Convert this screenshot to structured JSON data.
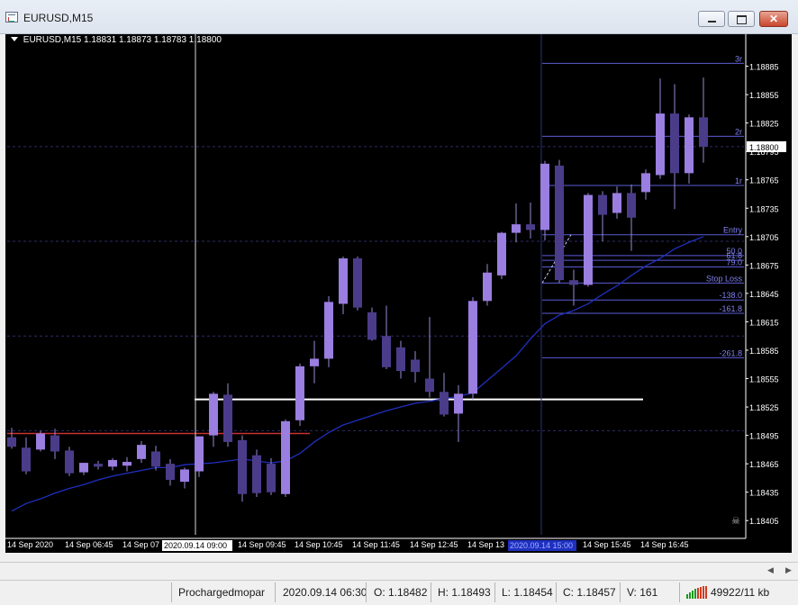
{
  "window": {
    "title": "EURUSD,M15"
  },
  "chart_header": {
    "symbol_tf": "EURUSD,M15",
    "ohlc": "1.18831 1.18873 1.18783 1.18800"
  },
  "chart_data": {
    "type": "candlestick",
    "title": "",
    "ylim": [
      1.1839,
      1.18915
    ],
    "price_ticks": [
      1.18885,
      1.18855,
      1.18825,
      1.18795,
      1.18765,
      1.18735,
      1.18705,
      1.18675,
      1.18645,
      1.18615,
      1.18585,
      1.18555,
      1.18525,
      1.18495,
      1.18465,
      1.18435,
      1.18405
    ],
    "price_tick_labels": [
      "1.18885",
      "1.18855",
      "1.18825",
      "1.18795",
      "1.18765",
      "1.18735",
      "1.18705",
      "1.18675",
      "1.18645",
      "1.18615",
      "1.18585",
      "1.18555",
      "1.18525",
      "1.18495",
      "1.18465",
      "1.18435",
      "1.18405"
    ],
    "time_labels": [
      "14 Sep 2020",
      "14 Sep 06:45",
      "14 Sep 07",
      "14 Sep 09:45",
      "14 Sep 10:45",
      "14 Sep 11:45",
      "14 Sep 12:45",
      "14 Sep 13",
      "14 Sep 15:45",
      "14 Sep 16:45"
    ],
    "crosshair_time_label": "2020.09.14 09:00",
    "cursor_time_label": "2020.09.14 15:00",
    "current_price_label": "1.18800",
    "candles": [
      {
        "o": 1.18493,
        "h": 1.18503,
        "l": 1.18481,
        "c": 1.18483
      },
      {
        "o": 1.18482,
        "h": 1.18493,
        "l": 1.18454,
        "c": 1.18457
      },
      {
        "o": 1.1848,
        "h": 1.185,
        "l": 1.18478,
        "c": 1.18497
      },
      {
        "o": 1.18495,
        "h": 1.18502,
        "l": 1.1847,
        "c": 1.18478
      },
      {
        "o": 1.18479,
        "h": 1.18483,
        "l": 1.18452,
        "c": 1.18455
      },
      {
        "o": 1.18456,
        "h": 1.18466,
        "l": 1.18453,
        "c": 1.18466
      },
      {
        "o": 1.18465,
        "h": 1.18468,
        "l": 1.18459,
        "c": 1.18462
      },
      {
        "o": 1.18462,
        "h": 1.18471,
        "l": 1.18458,
        "c": 1.18469
      },
      {
        "o": 1.18463,
        "h": 1.18472,
        "l": 1.18457,
        "c": 1.18467
      },
      {
        "o": 1.1847,
        "h": 1.18489,
        "l": 1.18466,
        "c": 1.18485
      },
      {
        "o": 1.18478,
        "h": 1.18484,
        "l": 1.18458,
        "c": 1.18462
      },
      {
        "o": 1.18465,
        "h": 1.1847,
        "l": 1.18442,
        "c": 1.18448
      },
      {
        "o": 1.18446,
        "h": 1.18461,
        "l": 1.18439,
        "c": 1.18459
      },
      {
        "o": 1.18457,
        "h": 1.18494,
        "l": 1.18451,
        "c": 1.18494
      },
      {
        "o": 1.18495,
        "h": 1.18541,
        "l": 1.18483,
        "c": 1.18539
      },
      {
        "o": 1.18538,
        "h": 1.1855,
        "l": 1.18483,
        "c": 1.18488
      },
      {
        "o": 1.1849,
        "h": 1.18495,
        "l": 1.18425,
        "c": 1.18433
      },
      {
        "o": 1.18474,
        "h": 1.1848,
        "l": 1.1843,
        "c": 1.18434
      },
      {
        "o": 1.18465,
        "h": 1.18471,
        "l": 1.18432,
        "c": 1.18435
      },
      {
        "o": 1.18433,
        "h": 1.18512,
        "l": 1.1843,
        "c": 1.1851
      },
      {
        "o": 1.18511,
        "h": 1.18571,
        "l": 1.18505,
        "c": 1.18568
      },
      {
        "o": 1.18568,
        "h": 1.18595,
        "l": 1.1855,
        "c": 1.18576
      },
      {
        "o": 1.18576,
        "h": 1.18642,
        "l": 1.18567,
        "c": 1.18636
      },
      {
        "o": 1.18634,
        "h": 1.18684,
        "l": 1.18623,
        "c": 1.18682
      },
      {
        "o": 1.18682,
        "h": 1.18684,
        "l": 1.18627,
        "c": 1.1863
      },
      {
        "o": 1.18625,
        "h": 1.1863,
        "l": 1.18595,
        "c": 1.18596
      },
      {
        "o": 1.186,
        "h": 1.18632,
        "l": 1.18565,
        "c": 1.18567
      },
      {
        "o": 1.18588,
        "h": 1.18595,
        "l": 1.18555,
        "c": 1.18563
      },
      {
        "o": 1.18575,
        "h": 1.18584,
        "l": 1.18551,
        "c": 1.18562
      },
      {
        "o": 1.18555,
        "h": 1.1862,
        "l": 1.18535,
        "c": 1.18541
      },
      {
        "o": 1.18541,
        "h": 1.18561,
        "l": 1.18515,
        "c": 1.18517
      },
      {
        "o": 1.18518,
        "h": 1.18548,
        "l": 1.18488,
        "c": 1.18539
      },
      {
        "o": 1.18539,
        "h": 1.18641,
        "l": 1.18533,
        "c": 1.18637
      },
      {
        "o": 1.18637,
        "h": 1.18676,
        "l": 1.18632,
        "c": 1.18667
      },
      {
        "o": 1.18664,
        "h": 1.1871,
        "l": 1.1866,
        "c": 1.18709
      },
      {
        "o": 1.18709,
        "h": 1.1874,
        "l": 1.18699,
        "c": 1.18718
      },
      {
        "o": 1.18718,
        "h": 1.18741,
        "l": 1.18703,
        "c": 1.18712
      },
      {
        "o": 1.18712,
        "h": 1.18785,
        "l": 1.18701,
        "c": 1.18782
      },
      {
        "o": 1.1878,
        "h": 1.18786,
        "l": 1.18656,
        "c": 1.18659
      },
      {
        "o": 1.18659,
        "h": 1.1867,
        "l": 1.18632,
        "c": 1.18654
      },
      {
        "o": 1.18654,
        "h": 1.18751,
        "l": 1.18652,
        "c": 1.18749
      },
      {
        "o": 1.18749,
        "h": 1.18753,
        "l": 1.187,
        "c": 1.18728
      },
      {
        "o": 1.1873,
        "h": 1.18758,
        "l": 1.18724,
        "c": 1.18751
      },
      {
        "o": 1.18751,
        "h": 1.1876,
        "l": 1.1869,
        "c": 1.18725
      },
      {
        "o": 1.18752,
        "h": 1.18776,
        "l": 1.18744,
        "c": 1.18772
      },
      {
        "o": 1.1877,
        "h": 1.18872,
        "l": 1.18766,
        "c": 1.18835
      },
      {
        "o": 1.18835,
        "h": 1.18866,
        "l": 1.18734,
        "c": 1.18772
      },
      {
        "o": 1.18772,
        "h": 1.18834,
        "l": 1.18761,
        "c": 1.18831
      },
      {
        "o": 1.18831,
        "h": 1.18873,
        "l": 1.18783,
        "c": 1.188
      }
    ],
    "moving_average": [
      1.18415,
      1.18423,
      1.18428,
      1.18434,
      1.18439,
      1.18443,
      1.18448,
      1.18452,
      1.18455,
      1.18458,
      1.18461,
      1.18461,
      1.18464,
      1.18465,
      1.18466,
      1.18468,
      1.1847,
      1.18468,
      1.18466,
      1.18468,
      1.18476,
      1.18488,
      1.18498,
      1.18506,
      1.18511,
      1.18516,
      1.18521,
      1.18525,
      1.18529,
      1.18531,
      1.18534,
      1.18536,
      1.1854,
      1.18553,
      1.18566,
      1.18579,
      1.18597,
      1.18613,
      1.18622,
      1.18627,
      1.18634,
      1.18644,
      1.18653,
      1.18664,
      1.18674,
      1.18682,
      1.18692,
      1.18699,
      1.18705
    ],
    "levels": [
      {
        "label": "3r",
        "price": 1.18888
      },
      {
        "label": "2r",
        "price": 1.18811
      },
      {
        "label": "1r",
        "price": 1.18759
      },
      {
        "label": "Entry",
        "price": 1.18707
      },
      {
        "label": "50.0",
        "price": 1.18685
      },
      {
        "label": "61.8",
        "price": 1.1868
      },
      {
        "label": "79.0",
        "price": 1.18673
      },
      {
        "label": "Stop Loss",
        "price": 1.18656
      },
      {
        "label": "-138.0",
        "price": 1.18638
      },
      {
        "label": "-161.8",
        "price": 1.18624
      },
      {
        "label": "-261.8",
        "price": 1.18577
      }
    ],
    "grid_prices": [
      1.188,
      1.187,
      1.186,
      1.185
    ],
    "white_level_price": 1.18533,
    "red_level_price": 1.18497,
    "colors": {
      "background": "#000000",
      "bull": "#9a7ee0",
      "bear": "#4b3c8a",
      "wick": "#9a8ad4",
      "ma": "#1f2fbf",
      "levels": "#5b5bd6",
      "level_text": "#8080f0",
      "grid": "#2c2c6a",
      "axis_text": "#ffffff"
    },
    "grid": true
  },
  "status": {
    "profile": "Prochargedmopar",
    "datetime": "2020.09.14 06:30",
    "open": "O: 1.18482",
    "high": "H: 1.18493",
    "low": "L: 1.18454",
    "close": "C: 1.18457",
    "volume": "V: 161",
    "traffic": "49922/11 kb"
  }
}
